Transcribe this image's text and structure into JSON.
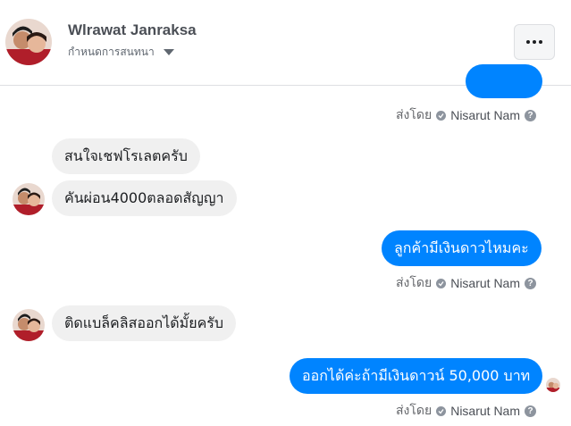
{
  "header": {
    "name": "Wlrawat Janraksa",
    "subtitle": "กำหนดการสนทนา",
    "more_label": "More options"
  },
  "sent_by": {
    "prefix": "ส่งโดย",
    "name": "Nisarut Nam",
    "help": "?"
  },
  "messages": [
    {
      "from": "them",
      "text": "สนใจเชฟโรเลตครับ"
    },
    {
      "from": "them",
      "text": "คันผ่อน4000ตลอดสัญญา"
    },
    {
      "from": "me",
      "text": "ลูกค้ามีเงินดาวไหมคะ"
    },
    {
      "from": "them",
      "text": "ติดแบล็คลิสออกได้มั้ยครับ"
    },
    {
      "from": "me",
      "text": "ออกได้ค่ะถ้ามีเงินดาวน์ 50,000 บาท"
    }
  ],
  "colors": {
    "outgoing": "#0084ff",
    "incoming": "#f0f0f0",
    "meta_text": "#65676b"
  }
}
